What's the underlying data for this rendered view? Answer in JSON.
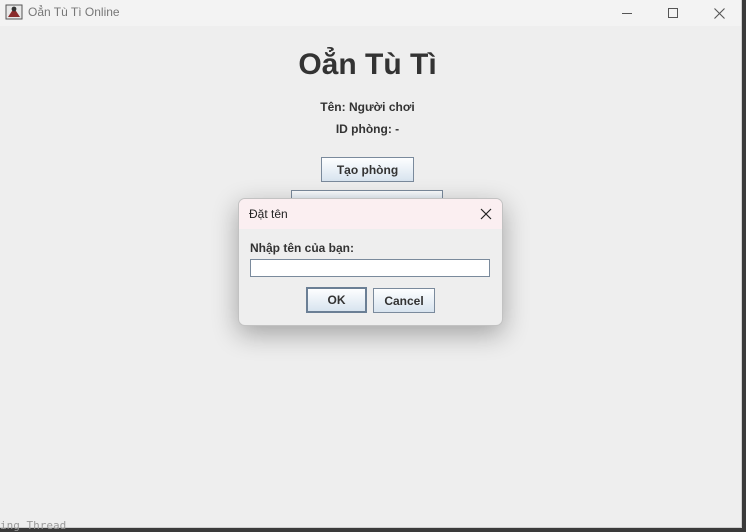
{
  "window": {
    "title": "Oẳn Tù Tì Online",
    "icons": {
      "app": "app-icon",
      "minimize": "minimize-icon",
      "maximize": "maximize-icon",
      "close": "close-icon"
    }
  },
  "main": {
    "heading": "Oẳn Tù Tì",
    "name_line": "Tên: Người chơi",
    "room_line": "ID phòng: -",
    "create_room_label": "Tạo phòng"
  },
  "dialog": {
    "title": "Đặt tên",
    "prompt": "Nhập tên của bạn:",
    "input_value": "",
    "ok_label": "OK",
    "cancel_label": "Cancel",
    "close_icon": "close-icon"
  },
  "background": {
    "console_text": "ing Thread"
  }
}
